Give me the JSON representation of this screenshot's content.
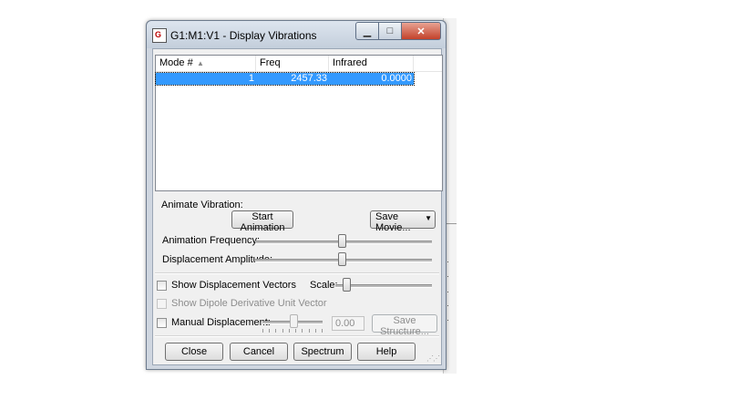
{
  "window": {
    "title": "G1:M1:V1 - Display Vibrations"
  },
  "table": {
    "columns": [
      "Mode #",
      "Freq",
      "Infrared"
    ],
    "rows": [
      {
        "mode": "1",
        "freq": "2457.33",
        "infrared": "0.0000"
      }
    ]
  },
  "animate": {
    "section_label": "Animate Vibration:",
    "start_label": "Start Animation",
    "save_movie_label": "Save Movie...",
    "freq_label": "Animation Frequency:",
    "freq_level": 0.5,
    "amp_label": "Displacement Amplitude:",
    "amp_level": 0.5
  },
  "options": {
    "show_vectors_label": "Show Displacement Vectors",
    "scale_label": "Scale:",
    "show_dipole_label": "Show Dipole Derivative Unit Vector",
    "manual_label": "Manual Displacement:",
    "manual_value": "0.00",
    "save_structure_label": "Save Structure..."
  },
  "buttons": {
    "close": "Close",
    "cancel": "Cancel",
    "spectrum": "Spectrum",
    "help": "Help"
  },
  "colors": {
    "selection": "#3399ff",
    "face": "#f0f0f0",
    "close_button": "#c3412a"
  }
}
